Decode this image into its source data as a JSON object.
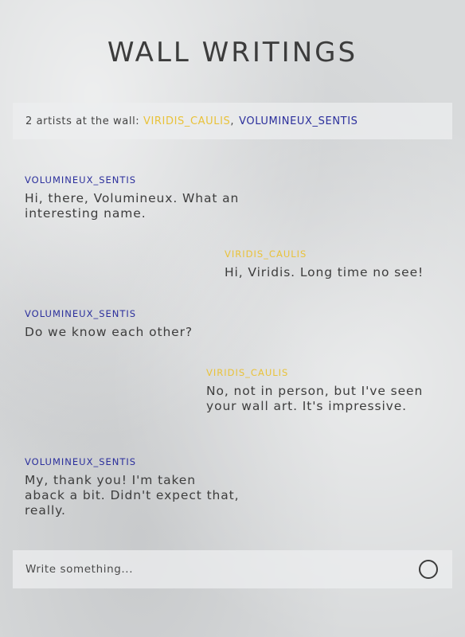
{
  "header": {
    "title": "WALL WRITINGS"
  },
  "artists_bar": {
    "prefix": "2 artists at the wall:",
    "artist_1": "VIRIDIS_CAULIS",
    "separator": ",",
    "artist_2": "VOLUMINEUX_SENTIS"
  },
  "messages": [
    {
      "author": "VOLUMINEUX_SENTIS",
      "text": "Hi, there, Volumineux. What an interesting name.",
      "side": "left"
    },
    {
      "author": "VIRIDIS_CAULIS",
      "text": "Hi, Viridis. Long time no see!",
      "side": "right"
    },
    {
      "author": "VOLUMINEUX_SENTIS",
      "text": "Do we know each other?",
      "side": "left"
    },
    {
      "author": "VIRIDIS_CAULIS",
      "text": "No, not in person, but I've seen your wall art. It's impressive.",
      "side": "right"
    },
    {
      "author": "VOLUMINEUX_SENTIS",
      "text": "My, thank you! I'm taken aback a bit. Didn't expect that, really.",
      "side": "left"
    }
  ],
  "composer": {
    "placeholder": "Write something...",
    "value": "",
    "send_icon": "circle-icon"
  },
  "colors": {
    "viridis": "#e9c23a",
    "volumineux": "#2b2f9c",
    "text": "#3d3d3d",
    "panel": "#eceeef"
  }
}
